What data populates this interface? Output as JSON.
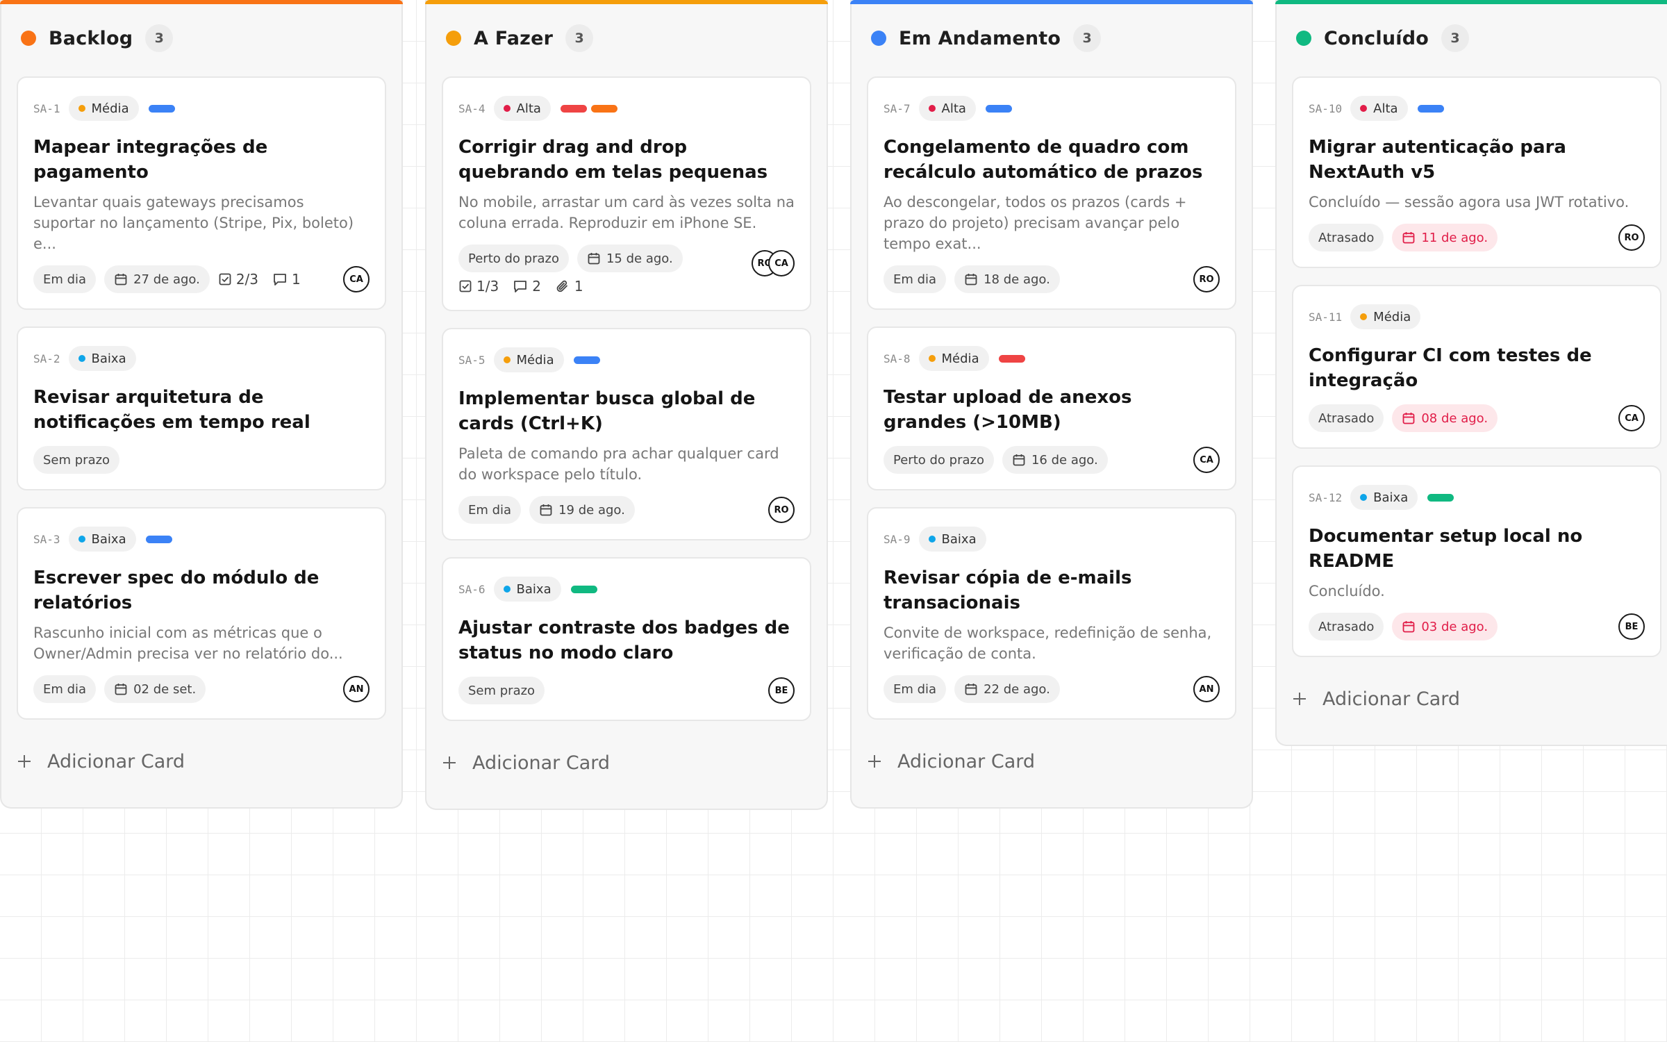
{
  "board": {
    "add_card_label": "Adicionar Card",
    "columns": [
      {
        "title": "Backlog",
        "count": "3",
        "color": "#f97316",
        "cards": [
          {
            "id": "SA-1",
            "priority": "Média",
            "priority_color": "#f59e0b",
            "labels": [
              "#3b82f6"
            ],
            "title": "Mapear integrações de pagamento",
            "description": "Levantar quais gateways precisamos suportar no lançamento (Stripe, Pix, boleto) e...",
            "status": "Em dia",
            "status_red": false,
            "date": "27 de ago.",
            "checklist": "2/3",
            "comments": "1",
            "attachments": "",
            "avatars": [
              "CA"
            ]
          },
          {
            "id": "SA-2",
            "priority": "Baixa",
            "priority_color": "#0ea5e9",
            "labels": [],
            "title": "Revisar arquitetura de notificações em tempo real",
            "description": "",
            "status": "Sem prazo",
            "status_red": false,
            "date": "",
            "checklist": "",
            "comments": "",
            "attachments": "",
            "avatars": []
          },
          {
            "id": "SA-3",
            "priority": "Baixa",
            "priority_color": "#0ea5e9",
            "labels": [
              "#3b82f6"
            ],
            "title": "Escrever spec do módulo de relatórios",
            "description": "Rascunho inicial com as métricas que o Owner/Admin precisa ver no relatório do...",
            "status": "Em dia",
            "status_red": false,
            "date": "02 de set.",
            "checklist": "",
            "comments": "",
            "attachments": "",
            "avatars": [
              "AN"
            ]
          }
        ]
      },
      {
        "title": "A Fazer",
        "count": "3",
        "color": "#f59e0b",
        "cards": [
          {
            "id": "SA-4",
            "priority": "Alta",
            "priority_color": "#e11d48",
            "labels": [
              "#ef4444",
              "#f97316"
            ],
            "title": "Corrigir drag and drop quebrando em telas pequenas",
            "description": "No mobile, arrastar um card às vezes solta na coluna errada. Reproduzir em iPhone SE.",
            "status": "Perto do prazo",
            "status_red": false,
            "date": "15 de ago.",
            "checklist": "1/3",
            "comments": "2",
            "attachments": "1",
            "avatars": [
              "RO",
              "CA"
            ],
            "second_row": true
          },
          {
            "id": "SA-5",
            "priority": "Média",
            "priority_color": "#f59e0b",
            "labels": [
              "#3b82f6"
            ],
            "title": "Implementar busca global de cards (Ctrl+K)",
            "description": "Paleta de comando pra achar qualquer card do workspace pelo título.",
            "status": "Em dia",
            "status_red": false,
            "date": "19 de ago.",
            "checklist": "",
            "comments": "",
            "attachments": "",
            "avatars": [
              "RO"
            ]
          },
          {
            "id": "SA-6",
            "priority": "Baixa",
            "priority_color": "#0ea5e9",
            "labels": [
              "#10b981"
            ],
            "title": "Ajustar contraste dos badges de status no modo claro",
            "description": "",
            "status": "Sem prazo",
            "status_red": false,
            "date": "",
            "checklist": "",
            "comments": "",
            "attachments": "",
            "avatars": [
              "BE"
            ]
          }
        ]
      },
      {
        "title": "Em Andamento",
        "count": "3",
        "color": "#3b82f6",
        "cards": [
          {
            "id": "SA-7",
            "priority": "Alta",
            "priority_color": "#e11d48",
            "labels": [
              "#3b82f6"
            ],
            "title": "Congelamento de quadro com recálculo automático de prazos",
            "description": "Ao descongelar, todos os prazos (cards + prazo do projeto) precisam avançar pelo tempo exat...",
            "status": "Em dia",
            "status_red": false,
            "date": "18 de ago.",
            "checklist": "",
            "comments": "",
            "attachments": "",
            "avatars": [
              "RO"
            ]
          },
          {
            "id": "SA-8",
            "priority": "Média",
            "priority_color": "#f59e0b",
            "labels": [
              "#ef4444"
            ],
            "title": "Testar upload de anexos grandes (>10MB)",
            "description": "",
            "status": "Perto do prazo",
            "status_red": false,
            "date": "16 de ago.",
            "checklist": "",
            "comments": "",
            "attachments": "",
            "avatars": [
              "CA"
            ]
          },
          {
            "id": "SA-9",
            "priority": "Baixa",
            "priority_color": "#0ea5e9",
            "labels": [],
            "title": "Revisar cópia de e-mails transacionais",
            "description": "Convite de workspace, redefinição de senha, verificação de conta.",
            "status": "Em dia",
            "status_red": false,
            "date": "22 de ago.",
            "checklist": "",
            "comments": "",
            "attachments": "",
            "avatars": [
              "AN"
            ]
          }
        ]
      },
      {
        "title": "Concluído",
        "count": "3",
        "color": "#10b981",
        "cards": [
          {
            "id": "SA-10",
            "priority": "Alta",
            "priority_color": "#e11d48",
            "labels": [
              "#3b82f6"
            ],
            "title": "Migrar autenticação para NextAuth v5",
            "description": "Concluído — sessão agora usa JWT rotativo.",
            "status": "Atrasado",
            "status_red": false,
            "date": "11 de ago.",
            "date_red": true,
            "checklist": "",
            "comments": "",
            "attachments": "",
            "avatars": [
              "RO"
            ]
          },
          {
            "id": "SA-11",
            "priority": "Média",
            "priority_color": "#f59e0b",
            "labels": [],
            "title": "Configurar CI com testes de integração",
            "description": "",
            "status": "Atrasado",
            "status_red": false,
            "date": "08 de ago.",
            "date_red": true,
            "checklist": "",
            "comments": "",
            "attachments": "",
            "avatars": [
              "CA"
            ]
          },
          {
            "id": "SA-12",
            "priority": "Baixa",
            "priority_color": "#0ea5e9",
            "labels": [
              "#10b981"
            ],
            "title": "Documentar setup local no README",
            "description": "Concluído.",
            "status": "Atrasado",
            "status_red": false,
            "date": "03 de ago.",
            "date_red": true,
            "checklist": "",
            "comments": "",
            "attachments": "",
            "avatars": [
              "BE"
            ]
          }
        ]
      }
    ]
  },
  "icons": {
    "calendar": "calendar-icon",
    "checklist": "checklist-icon",
    "comment": "comment-icon",
    "attachment": "paperclip-icon",
    "add": "plus-icon"
  }
}
